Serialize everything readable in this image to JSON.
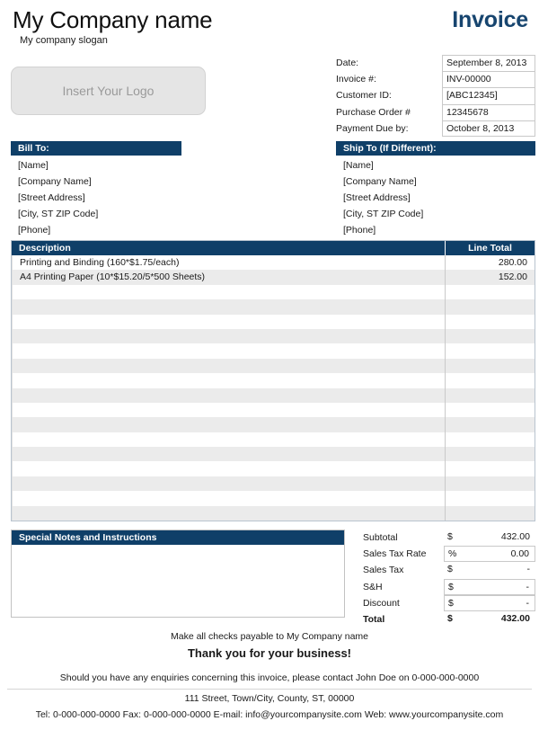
{
  "header": {
    "company_name": "My Company name",
    "slogan": "My company slogan",
    "invoice_title": "Invoice",
    "logo_placeholder": "Insert Your Logo"
  },
  "meta": {
    "rows": [
      {
        "label": "Date:",
        "value": "September 8, 2013"
      },
      {
        "label": "Invoice #:",
        "value": "INV-00000"
      },
      {
        "label": "Customer ID:",
        "value": "[ABC12345]"
      },
      {
        "label": "Purchase Order #",
        "value": "12345678"
      },
      {
        "label": "Payment Due by:",
        "value": "October 8, 2013"
      }
    ]
  },
  "bill_to": {
    "title": "Bill To:",
    "lines": [
      "[Name]",
      "[Company Name]",
      "[Street Address]",
      "[City, ST  ZIP Code]",
      "[Phone]"
    ]
  },
  "ship_to": {
    "title": "Ship To (If Different):",
    "lines": [
      "[Name]",
      "[Company Name]",
      "[Street Address]",
      "[City, ST  ZIP Code]",
      "[Phone]"
    ]
  },
  "items": {
    "columns": {
      "description": "Description",
      "line_total": "Line Total"
    },
    "rows": [
      {
        "description": "Printing and Binding (160*$1.75/each)",
        "line_total": "280.00"
      },
      {
        "description": "A4 Printing Paper (10*$15.20/5*500 Sheets)",
        "line_total": "152.00"
      },
      {
        "description": "",
        "line_total": ""
      },
      {
        "description": "",
        "line_total": ""
      },
      {
        "description": "",
        "line_total": ""
      },
      {
        "description": "",
        "line_total": ""
      },
      {
        "description": "",
        "line_total": ""
      },
      {
        "description": "",
        "line_total": ""
      },
      {
        "description": "",
        "line_total": ""
      },
      {
        "description": "",
        "line_total": ""
      },
      {
        "description": "",
        "line_total": ""
      },
      {
        "description": "",
        "line_total": ""
      },
      {
        "description": "",
        "line_total": ""
      },
      {
        "description": "",
        "line_total": ""
      },
      {
        "description": "",
        "line_total": ""
      },
      {
        "description": "",
        "line_total": ""
      },
      {
        "description": "",
        "line_total": ""
      },
      {
        "description": "",
        "line_total": ""
      }
    ]
  },
  "notes": {
    "title": "Special Notes and Instructions",
    "body": ""
  },
  "totals": {
    "rows": [
      {
        "label": "Subtotal",
        "symbol": "$",
        "value": "432.00",
        "boxed": false,
        "bold": false
      },
      {
        "label": "Sales Tax Rate",
        "symbol": "%",
        "value": "0.00",
        "boxed": true,
        "bold": false
      },
      {
        "label": "Sales Tax",
        "symbol": "$",
        "value": "-",
        "boxed": false,
        "bold": false
      },
      {
        "label": "S&H",
        "symbol": "$",
        "value": "-",
        "boxed": true,
        "bold": false
      },
      {
        "label": "Discount",
        "symbol": "$",
        "value": "-",
        "boxed": true,
        "bold": false
      },
      {
        "label": "Total",
        "symbol": "$",
        "value": "432.00",
        "boxed": false,
        "bold": true
      }
    ]
  },
  "footer": {
    "payable": "Make all checks payable to My Company name",
    "thanks": "Thank you for your business!",
    "enquiries": "Should you have any enquiries concerning this invoice, please contact John Doe on 0-000-000-0000",
    "address": "111 Street, Town/City, County, ST, 00000",
    "contact": "Tel: 0-000-000-0000 Fax: 0-000-000-0000 E-mail: info@yourcompanysite.com Web: www.yourcompanysite.com"
  },
  "colors": {
    "accent_navy": "#0f3f68",
    "title_navy": "#17456f",
    "row_stripe": "#ebebeb",
    "logo_fill": "#e5e5e5"
  }
}
